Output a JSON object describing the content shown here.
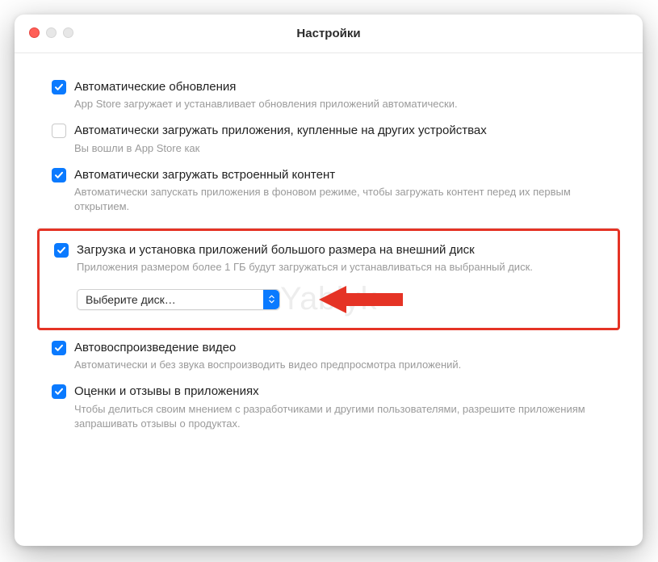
{
  "window": {
    "title": "Настройки"
  },
  "watermark": "Yablyk",
  "group1": {
    "opt1": {
      "label": "Автоматические обновления",
      "desc": "App Store загружает и устанавливает обновления приложений автоматически.",
      "checked": true
    },
    "opt2": {
      "label": "Автоматически загружать приложения, купленные на других устройствах",
      "desc": "Вы вошли в App Store как",
      "checked": false
    },
    "opt3": {
      "label": "Автоматически загружать встроенный контент",
      "desc": "Автоматически запускать приложения в фоновом режиме, чтобы загружать контент перед их первым открытием.",
      "checked": true
    }
  },
  "group2": {
    "opt": {
      "label": "Загрузка и установка приложений большого размера на внешний диск",
      "desc": "Приложения размером более 1 ГБ будут загружаться и устанавливаться на выбранный диск.",
      "checked": true
    },
    "select": {
      "value": "Выберите диск…"
    }
  },
  "group3": {
    "opt1": {
      "label": "Автовоспроизведение видео",
      "desc": "Автоматически и без звука воспроизводить видео предпросмотра приложений.",
      "checked": true
    },
    "opt2": {
      "label": "Оценки и отзывы в приложениях",
      "desc": "Чтобы делиться своим мнением с разработчиками и другими пользователями, разрешите приложениям запрашивать отзывы о продуктах.",
      "checked": true
    }
  }
}
